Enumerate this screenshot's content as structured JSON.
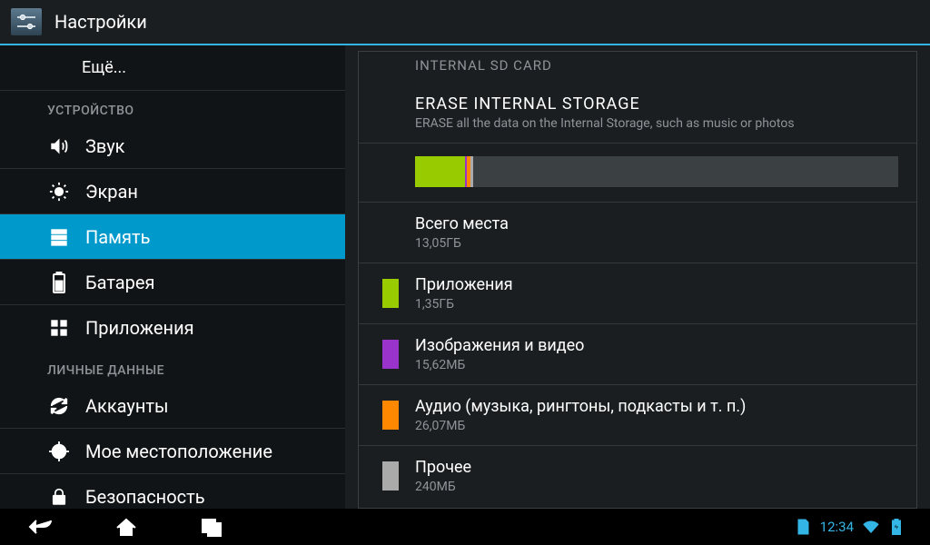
{
  "action_bar": {
    "title": "Настройки"
  },
  "sidebar": {
    "more": "Ещё...",
    "header_device": "УСТРОЙСТВО",
    "items_device": [
      {
        "label": "Звук",
        "icon": "volume-icon"
      },
      {
        "label": "Экран",
        "icon": "brightness-icon"
      },
      {
        "label": "Память",
        "icon": "storage-icon",
        "selected": true
      },
      {
        "label": "Батарея",
        "icon": "battery-icon"
      },
      {
        "label": "Приложения",
        "icon": "apps-icon"
      }
    ],
    "header_personal": "ЛИЧНЫЕ ДАННЫЕ",
    "items_personal": [
      {
        "label": "Аккаунты",
        "icon": "sync-icon"
      },
      {
        "label": "Мое местоположение",
        "icon": "location-icon"
      },
      {
        "label": "Безопасность",
        "icon": "lock-icon"
      }
    ]
  },
  "content": {
    "section_header": "INTERNAL SD CARD",
    "erase": {
      "title": "ERASE INTERNAL STORAGE",
      "subtitle": "ERASE all the data on the Internal Storage, such as music or photos"
    },
    "bar_segments": [
      {
        "class": "c-apps",
        "percent": 10.3
      },
      {
        "class": "c-pics",
        "percent": 0.5
      },
      {
        "class": "c-audio",
        "percent": 0.7
      },
      {
        "class": "c-other",
        "percent": 0.5
      }
    ],
    "total": {
      "title": "Всего места",
      "sub": "13,05ГБ"
    },
    "apps": {
      "title": "Приложения",
      "sub": "1,35ГБ",
      "swatch": "c-apps"
    },
    "pics": {
      "title": "Изображения и видео",
      "sub": "15,62МБ",
      "swatch": "c-pics"
    },
    "audio": {
      "title": "Аудио (музыка, рингтоны, подкасты и т. п.)",
      "sub": "26,07МБ",
      "swatch": "c-audio"
    },
    "other": {
      "title": "Прочее",
      "sub": "240МБ",
      "swatch": "c-other"
    }
  },
  "navbar": {
    "clock": "12:34"
  },
  "colors": {
    "accent": "#33b5e5",
    "apps": "#99cc00",
    "pics": "#9933cc",
    "audio": "#ff8800",
    "other": "#aaaaaa"
  }
}
